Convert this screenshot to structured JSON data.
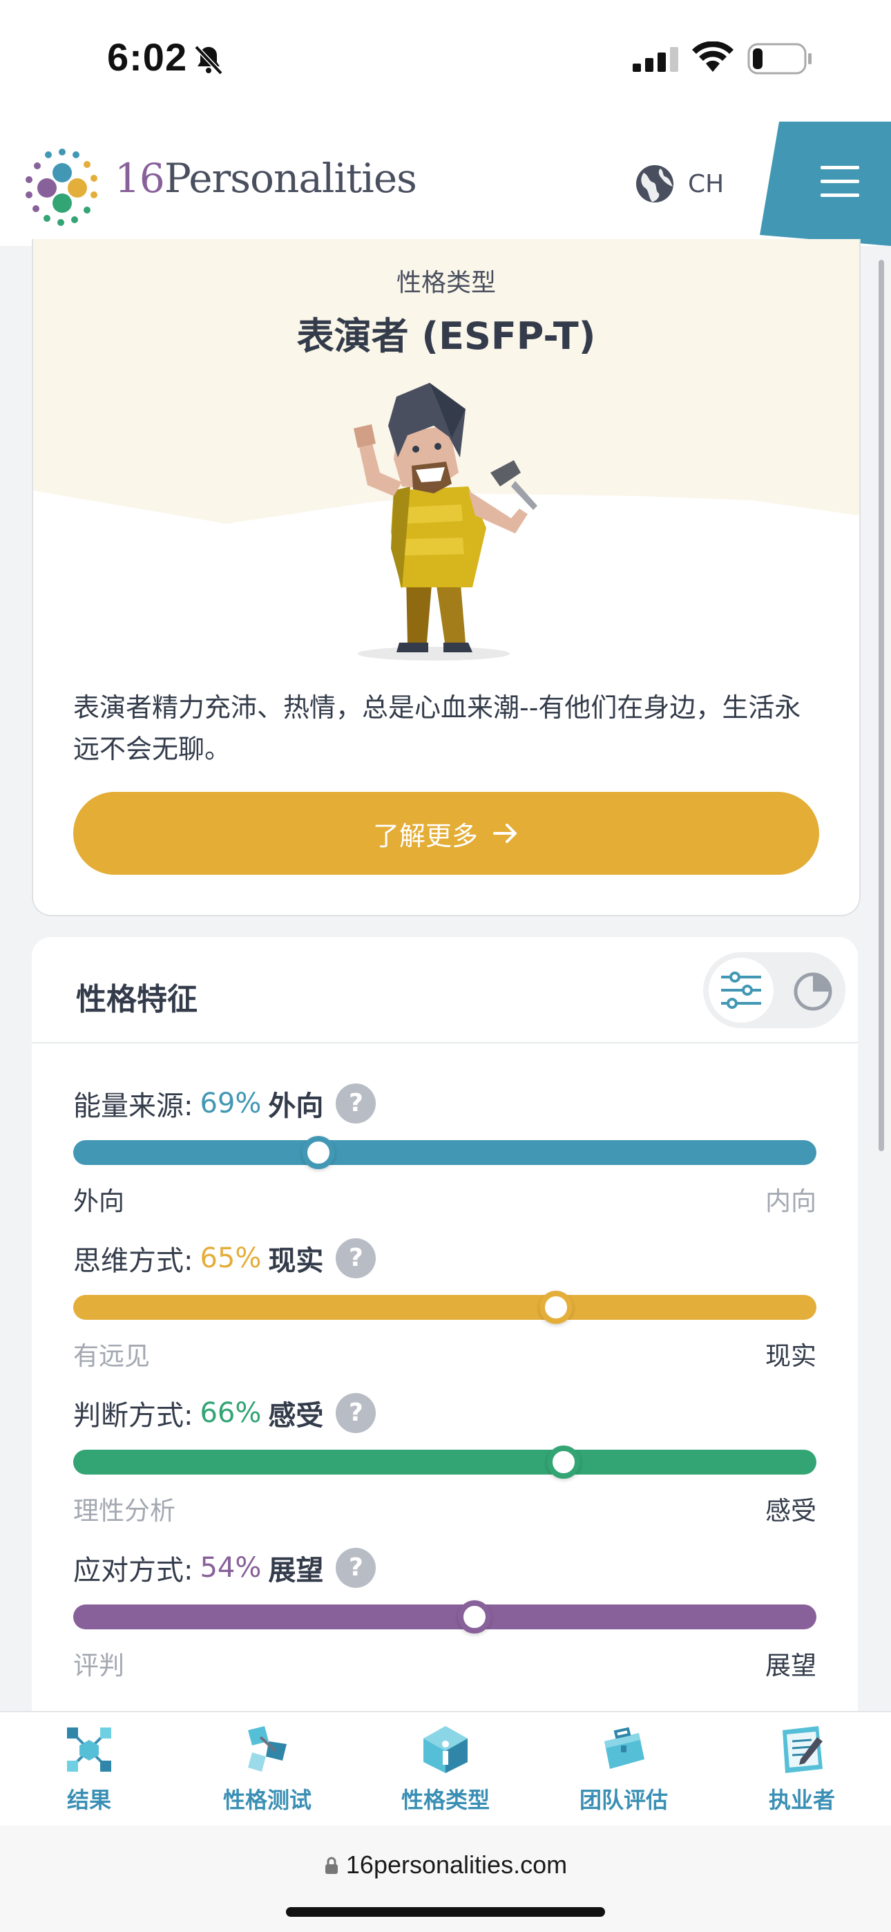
{
  "status_bar": {
    "time": "6:02"
  },
  "header": {
    "logo_number": "16",
    "logo_word": "Personalities",
    "language": "CH"
  },
  "type_card": {
    "label": "性格类型",
    "name": "表演者 (ESFP-T)",
    "description": "表演者精力充沛、热情，总是心血来潮--有他们在身边，生活永远不会无聊。",
    "learn_more": "了解更多"
  },
  "traits": {
    "title": "性格特征",
    "items": [
      {
        "label": "能量来源:",
        "percent": "69%",
        "side": "外向",
        "left": "外向",
        "right": "内向",
        "position": 0.33,
        "color": "#4298b4",
        "active": "left"
      },
      {
        "label": "思维方式:",
        "percent": "65%",
        "side": "现实",
        "left": "有远见",
        "right": "现实",
        "position": 0.65,
        "color": "#e4ae3a",
        "active": "right"
      },
      {
        "label": "判断方式:",
        "percent": "66%",
        "side": "感受",
        "left": "理性分析",
        "right": "感受",
        "position": 0.66,
        "color": "#33a474",
        "active": "right"
      },
      {
        "label": "应对方式:",
        "percent": "54%",
        "side": "展望",
        "left": "评判",
        "right": "展望",
        "position": 0.54,
        "color": "#88619a",
        "active": "right"
      }
    ]
  },
  "bottom_nav": [
    {
      "label": "结果",
      "icon": "results-molecule-icon"
    },
    {
      "label": "性格测试",
      "icon": "personality-test-icon"
    },
    {
      "label": "性格类型",
      "icon": "personality-types-icon"
    },
    {
      "label": "团队评估",
      "icon": "team-briefcase-icon"
    },
    {
      "label": "执业者",
      "icon": "professional-notepad-icon"
    }
  ],
  "browser": {
    "url": "16personalities.com"
  }
}
